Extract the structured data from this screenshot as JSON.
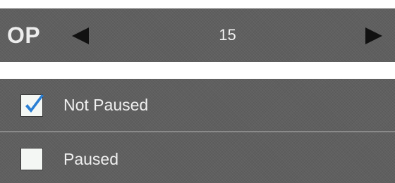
{
  "selector": {
    "label": "OP",
    "value": "15",
    "prev_icon": "triangle-left",
    "next_icon": "triangle-right"
  },
  "options": [
    {
      "label": "Not Paused",
      "checked": true
    },
    {
      "label": "Paused",
      "checked": false
    }
  ],
  "colors": {
    "panel_bg": "#5f5f5f",
    "text": "#f0f0f0",
    "checkmark": "#2a7fd4",
    "checkbox_bg": "#f4f7f4"
  }
}
